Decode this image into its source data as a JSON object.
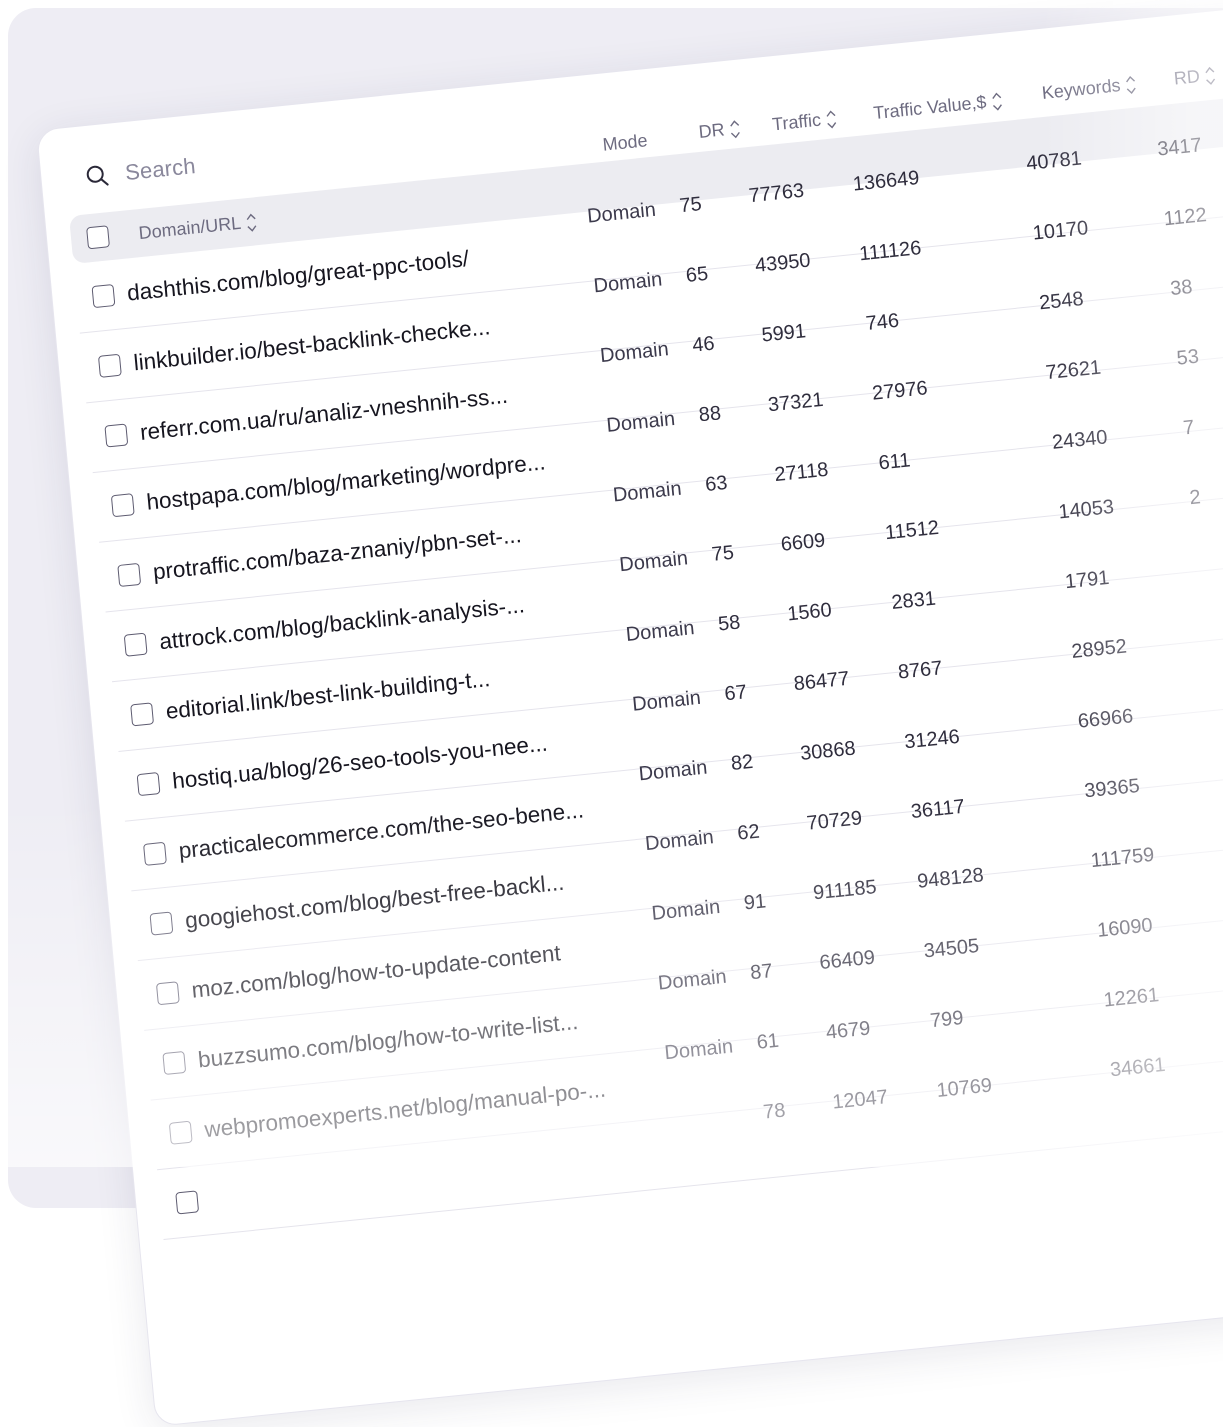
{
  "search": {
    "placeholder": "Search"
  },
  "columns": {
    "domain": "Domain/URL",
    "mode": "Mode",
    "dr": "DR",
    "traffic": "Traffic",
    "traffic_value": "Traffic Value,$",
    "keywords": "Keywords",
    "rd": "RD"
  },
  "rows": [
    {
      "url": "dashthis.com/blog/great-ppc-tools/",
      "mode": "Domain",
      "dr": "75",
      "traffic": "77763",
      "value": "136649",
      "keywords": "40781",
      "rd": "3417"
    },
    {
      "url": "linkbuilder.io/best-backlink-checke...",
      "mode": "Domain",
      "dr": "65",
      "traffic": "43950",
      "value": "111126",
      "keywords": "10170",
      "rd": "1122"
    },
    {
      "url": "referr.com.ua/ru/analiz-vneshnih-ss...",
      "mode": "Domain",
      "dr": "46",
      "traffic": "5991",
      "value": "746",
      "keywords": "2548",
      "rd": "38"
    },
    {
      "url": "hostpapa.com/blog/marketing/wordpre...",
      "mode": "Domain",
      "dr": "88",
      "traffic": "37321",
      "value": "27976",
      "keywords": "72621",
      "rd": "53"
    },
    {
      "url": "protraffic.com/baza-znaniy/pbn-set-...",
      "mode": "Domain",
      "dr": "63",
      "traffic": "27118",
      "value": "611",
      "keywords": "24340",
      "rd": "7"
    },
    {
      "url": "attrock.com/blog/backlink-analysis-...",
      "mode": "Domain",
      "dr": "75",
      "traffic": "6609",
      "value": "11512",
      "keywords": "14053",
      "rd": "2"
    },
    {
      "url": "editorial.link/best-link-building-t...",
      "mode": "Domain",
      "dr": "58",
      "traffic": "1560",
      "value": "2831",
      "keywords": "1791",
      "rd": ""
    },
    {
      "url": "hostiq.ua/blog/26-seo-tools-you-nee...",
      "mode": "Domain",
      "dr": "67",
      "traffic": "86477",
      "value": "8767",
      "keywords": "28952",
      "rd": ""
    },
    {
      "url": "practicalecommerce.com/the-seo-bene...",
      "mode": "Domain",
      "dr": "82",
      "traffic": "30868",
      "value": "31246",
      "keywords": "66966",
      "rd": ""
    },
    {
      "url": "googiehost.com/blog/best-free-backl...",
      "mode": "Domain",
      "dr": "62",
      "traffic": "70729",
      "value": "36117",
      "keywords": "39365",
      "rd": ""
    },
    {
      "url": "moz.com/blog/how-to-update-content",
      "mode": "Domain",
      "dr": "91",
      "traffic": "911185",
      "value": "948128",
      "keywords": "111759",
      "rd": ""
    },
    {
      "url": "buzzsumo.com/blog/how-to-write-list...",
      "mode": "Domain",
      "dr": "87",
      "traffic": "66409",
      "value": "34505",
      "keywords": "16090",
      "rd": ""
    },
    {
      "url": "webpromoexperts.net/blog/manual-po-...",
      "mode": "Domain",
      "dr": "61",
      "traffic": "4679",
      "value": "799",
      "keywords": "12261",
      "rd": ""
    },
    {
      "url": "",
      "mode": "",
      "dr": "78",
      "traffic": "12047",
      "value": "10769",
      "keywords": "34661",
      "rd": ""
    }
  ]
}
